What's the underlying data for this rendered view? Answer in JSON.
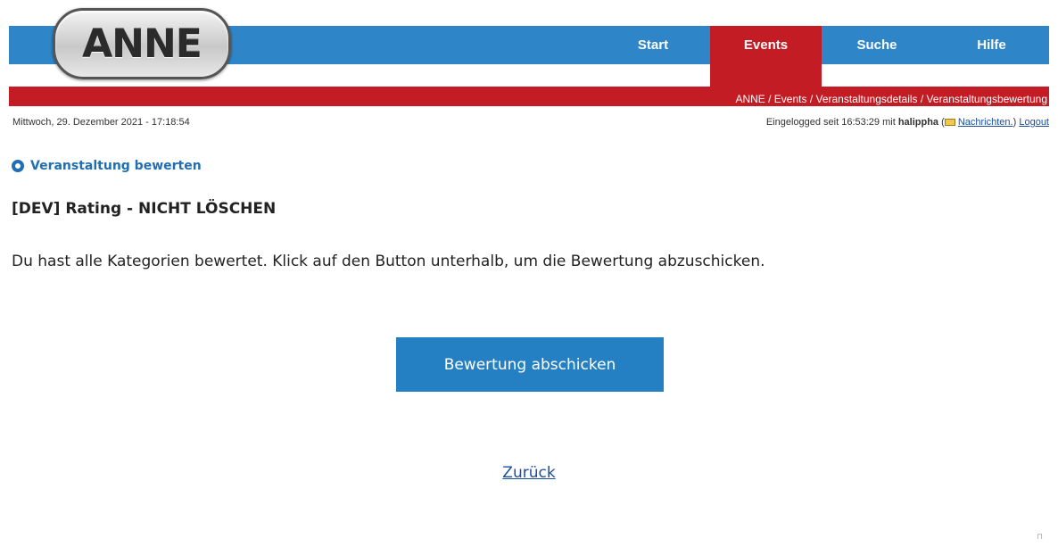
{
  "app": {
    "logo_text": "ANNE"
  },
  "nav": {
    "tabs": [
      {
        "label": "Start",
        "active": false
      },
      {
        "label": "Events",
        "active": true
      },
      {
        "label": "Suche",
        "active": false
      },
      {
        "label": "Hilfe",
        "active": false
      }
    ]
  },
  "breadcrumb": "ANNE / Events / Veranstaltungsdetails / Veranstaltungsbewertung",
  "infobar": {
    "datetime": "Mittwoch, 29. Dezember 2021 - 17:18:54",
    "login_prefix": "Eingelogged seit 16:53:29 mit",
    "username": "halippha",
    "messages_open": "(",
    "messages_link": "Nachrichten.",
    "messages_close": ")",
    "logout": "Logout"
  },
  "main": {
    "section_title": "Veranstaltung bewerten",
    "event_title": "[DEV] Rating - NICHT LÖSCHEN",
    "message": "Du hast alle Kategorien bewertet. Klick auf den Button unterhalb, um die Bewertung abzuschicken.",
    "submit_label": "Bewertung abschicken",
    "back_label": "Zurück"
  },
  "colors": {
    "nav_blue": "#2e86c9",
    "accent_red": "#c41c24",
    "button_blue": "#2580c3",
    "link_blue": "#1a4fa0"
  },
  "icons": [
    "mail-icon",
    "radio-ring-icon",
    "resize-corner-icon"
  ]
}
